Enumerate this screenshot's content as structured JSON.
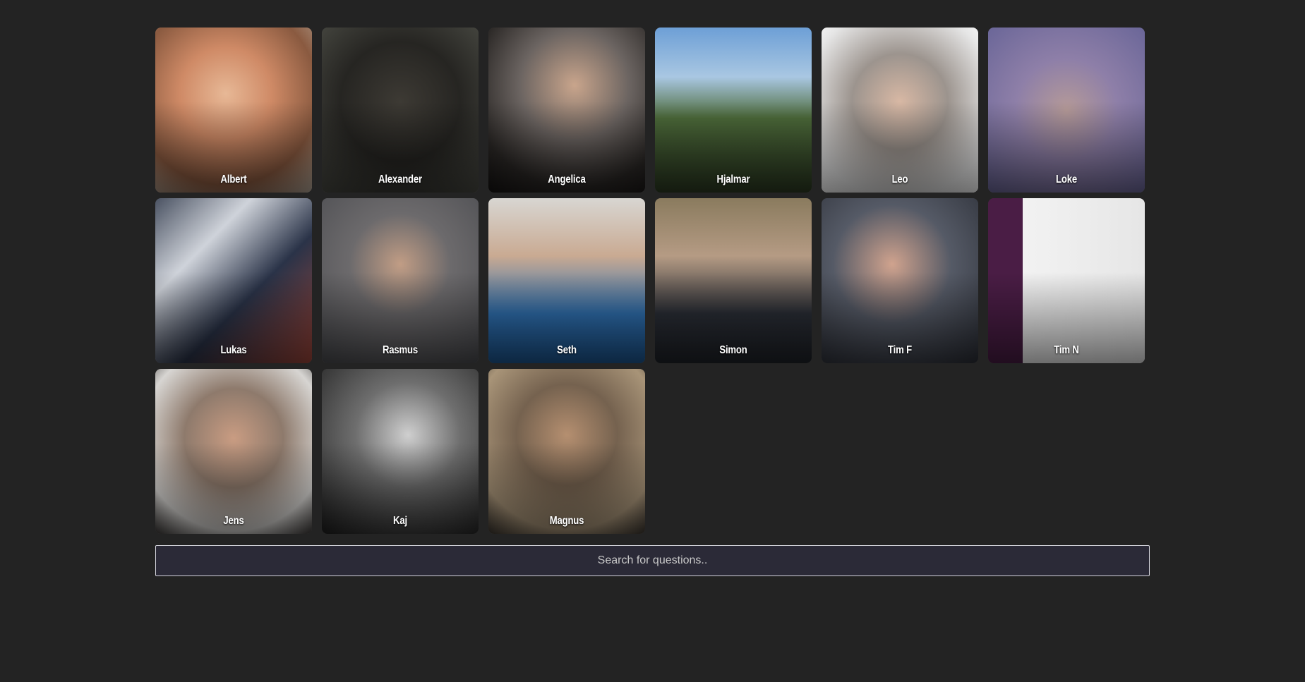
{
  "people": [
    {
      "name": "Albert",
      "bg": "radial-gradient(circle at 45% 40%, #e7b896 0%, #cf8a66 35%, #8a5a40 70%, #b6a99a 100%)"
    },
    {
      "name": "Alexander",
      "bg": "radial-gradient(circle at 50% 45%, #3d3a34 0%, #262522 50%, #4a4b44 100%)"
    },
    {
      "name": "Angelica",
      "bg": "radial-gradient(circle at 55% 35%, #c9a58c 0%, #6b6461 40%, #2a2725 75%, #151312 100%)"
    },
    {
      "name": "Hjalmar",
      "bg": "linear-gradient(to bottom, #6d9fd6 0%, #a9c7e2 30%, #4d6b3a 55%, #2c3a22 100%)"
    },
    {
      "name": "Leo",
      "bg": "radial-gradient(circle at 50% 45%, #d8b8a4 0%, #9c948e 40%, #e6e6e6 80%, #ffffff 100%)"
    },
    {
      "name": "Loke",
      "bg": "radial-gradient(circle at 50% 50%, #b59a98 0%, #8e7fa8 45%, #6a6698 100%)"
    },
    {
      "name": "Lukas",
      "bg": "linear-gradient(135deg, #4a5262 0%, #cfd3da 30%, #2a3348 60%, #a0463a 100%)"
    },
    {
      "name": "Rasmus",
      "bg": "radial-gradient(circle at 50% 40%, #c19d85 0%, #6c6a6c 40%, #4a4b4f 100%)"
    },
    {
      "name": "Seth",
      "bg": "linear-gradient(to bottom, #d8d6d2 0%, #c9aa92 35%, #2f6fae 70%, #1d5690 100%)"
    },
    {
      "name": "Simon",
      "bg": "linear-gradient(to bottom, #8a7b5e 0%, #b59b84 35%, #2a2e36 70%, #1f2228 100%)"
    },
    {
      "name": "Tim F",
      "bg": "radial-gradient(circle at 45% 40%, #d0a38e 0%, #555a66 45%, #2b2e36 100%)"
    },
    {
      "name": "Tim N",
      "bg": "linear-gradient(to right, #4a1d45 0%, #4a1d45 22%, #f2f2f2 22%, #e6e6e6 100%)"
    },
    {
      "name": "Jens",
      "bg": "radial-gradient(circle at 50% 42%, #c99c82 0%, #8e7a6c 40%, #d7d5d2 75%, #3a3736 100%)"
    },
    {
      "name": "Kaj",
      "bg": "radial-gradient(circle at 55% 40%, #cfcfcf 0%, #6e6e6e 40%, #1e1e1e 100%)"
    },
    {
      "name": "Magnus",
      "bg": "radial-gradient(circle at 50% 40%, #b58f70 0%, #75624f 40%, #a89478 75%, #3a352f 100%)"
    }
  ],
  "search": {
    "placeholder": "Search for questions.."
  }
}
